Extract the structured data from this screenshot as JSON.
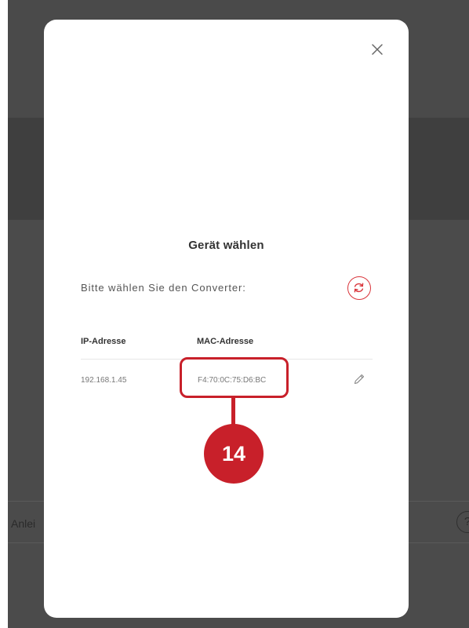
{
  "background": {
    "row_label": "Anlei",
    "help_icon_text": "?"
  },
  "modal": {
    "title": "Gerät wählen",
    "prompt": "Bitte wählen Sie den Converter:",
    "close_icon": "close-icon",
    "refresh_icon": "refresh-icon",
    "table": {
      "headers": [
        "IP-Adresse",
        "MAC-Adresse"
      ],
      "rows": [
        {
          "ip": "192.168.1.45",
          "mac": "F4:70:0C:75:D6:BC",
          "action_icon": "pencil-icon"
        }
      ]
    }
  },
  "annotation": {
    "badge": "14",
    "color": "#c8202a"
  }
}
